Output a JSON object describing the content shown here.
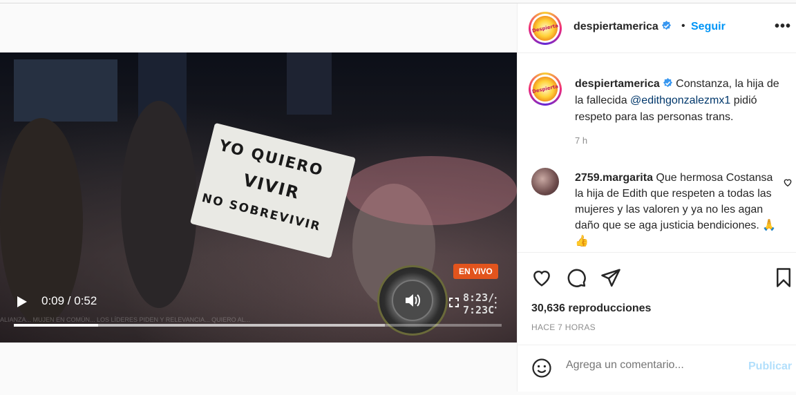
{
  "video": {
    "time_display": "0:09 / 0:52",
    "progress_fraction": 0.173,
    "buffered_fraction": 0.76,
    "live_badge": "EN VIVO",
    "clock_line1": "8:23/",
    "clock_line2": "7:23C",
    "banner_line1": "YO QUIERO",
    "banner_line2": "VIVIR",
    "banner_line3": "NO SOBREVIVIR",
    "ticker": "ALIANZA... MUJEN EN COMÚN... LOS LÍDERES PIDEN Y RELEVANCIA... QUIERO AL..."
  },
  "header": {
    "username": "despiertamerica",
    "separator": "•",
    "follow_label": "Seguir",
    "options_label": "•••",
    "avatar_text": "Despierta"
  },
  "caption": {
    "username": "despiertamerica",
    "text_before": " Constanza, la hija de la fallecida ",
    "mention": "@edithgonzalezmx1",
    "text_after": " pidió respeto para las personas trans.",
    "time": "7 h"
  },
  "comment": {
    "username": "2759.margarita",
    "text": " Que hermosa Costansa la hija de Edith que respeten a todas las mujeres y las valoren y ya no les agan daño que se aga justicia bendiciones. 🙏 👍"
  },
  "stats": {
    "views": "30,636 reproducciones",
    "posted": "HACE 7 HORAS"
  },
  "add_comment": {
    "placeholder": "Agrega un comentario...",
    "post_label": "Publicar"
  },
  "colors": {
    "accent": "#0095f6",
    "live": "#e2541d",
    "post_disabled": "#b2dffc"
  }
}
